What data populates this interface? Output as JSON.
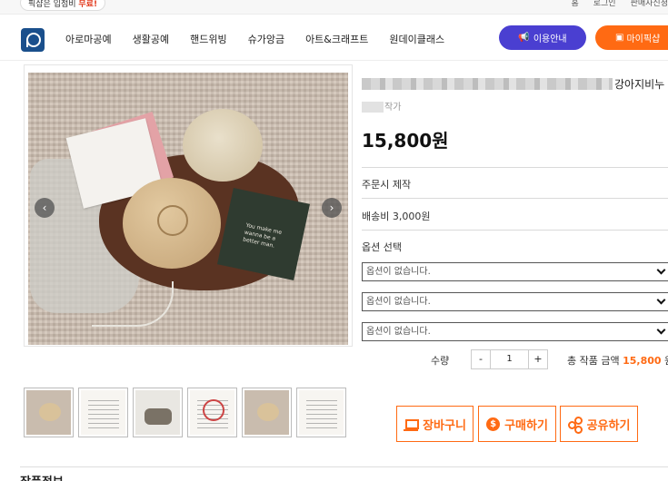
{
  "topbar": {
    "promo_prefix": "픽샵은 입점비 ",
    "promo_highlight": "무료!",
    "links": [
      "홈",
      "로그인",
      "판매자신청"
    ]
  },
  "nav": {
    "menu": [
      "아로마공예",
      "생활공예",
      "핸드위빙",
      "슈가앙금",
      "아트&크래프트",
      "원데이클래스"
    ],
    "guide_button": "이용안내",
    "mypick_button": "마이픽샵"
  },
  "gallery": {
    "card_text": "You make me wanna be a better man.",
    "thumbnails": [
      "photo",
      "text-card",
      "photo",
      "round-label",
      "photo",
      "text-card"
    ]
  },
  "product": {
    "name_visible": "강아지비누",
    "artist_suffix": "작가",
    "price": "15,800원",
    "production": "주문시 제작",
    "shipping": "배송비 3,000원",
    "options_label": "옵션 선택",
    "options": [
      "옵션이 없습니다.",
      "옵션이 없습니다.",
      "옵션이 없습니다."
    ],
    "qty_label": "수량",
    "qty_minus": "-",
    "qty_value": "1",
    "qty_plus": "+",
    "total_label": "총 작품 금액 ",
    "total_amount": "15,800",
    "total_unit": " 원"
  },
  "actions": {
    "cart": "장바구니",
    "buy": "구매하기",
    "share": "공유하기"
  },
  "section": {
    "title": "작품정보"
  },
  "colors": {
    "accent": "#ff6a13",
    "guide": "#4a3fd1",
    "logo": "#1a4f8c"
  }
}
